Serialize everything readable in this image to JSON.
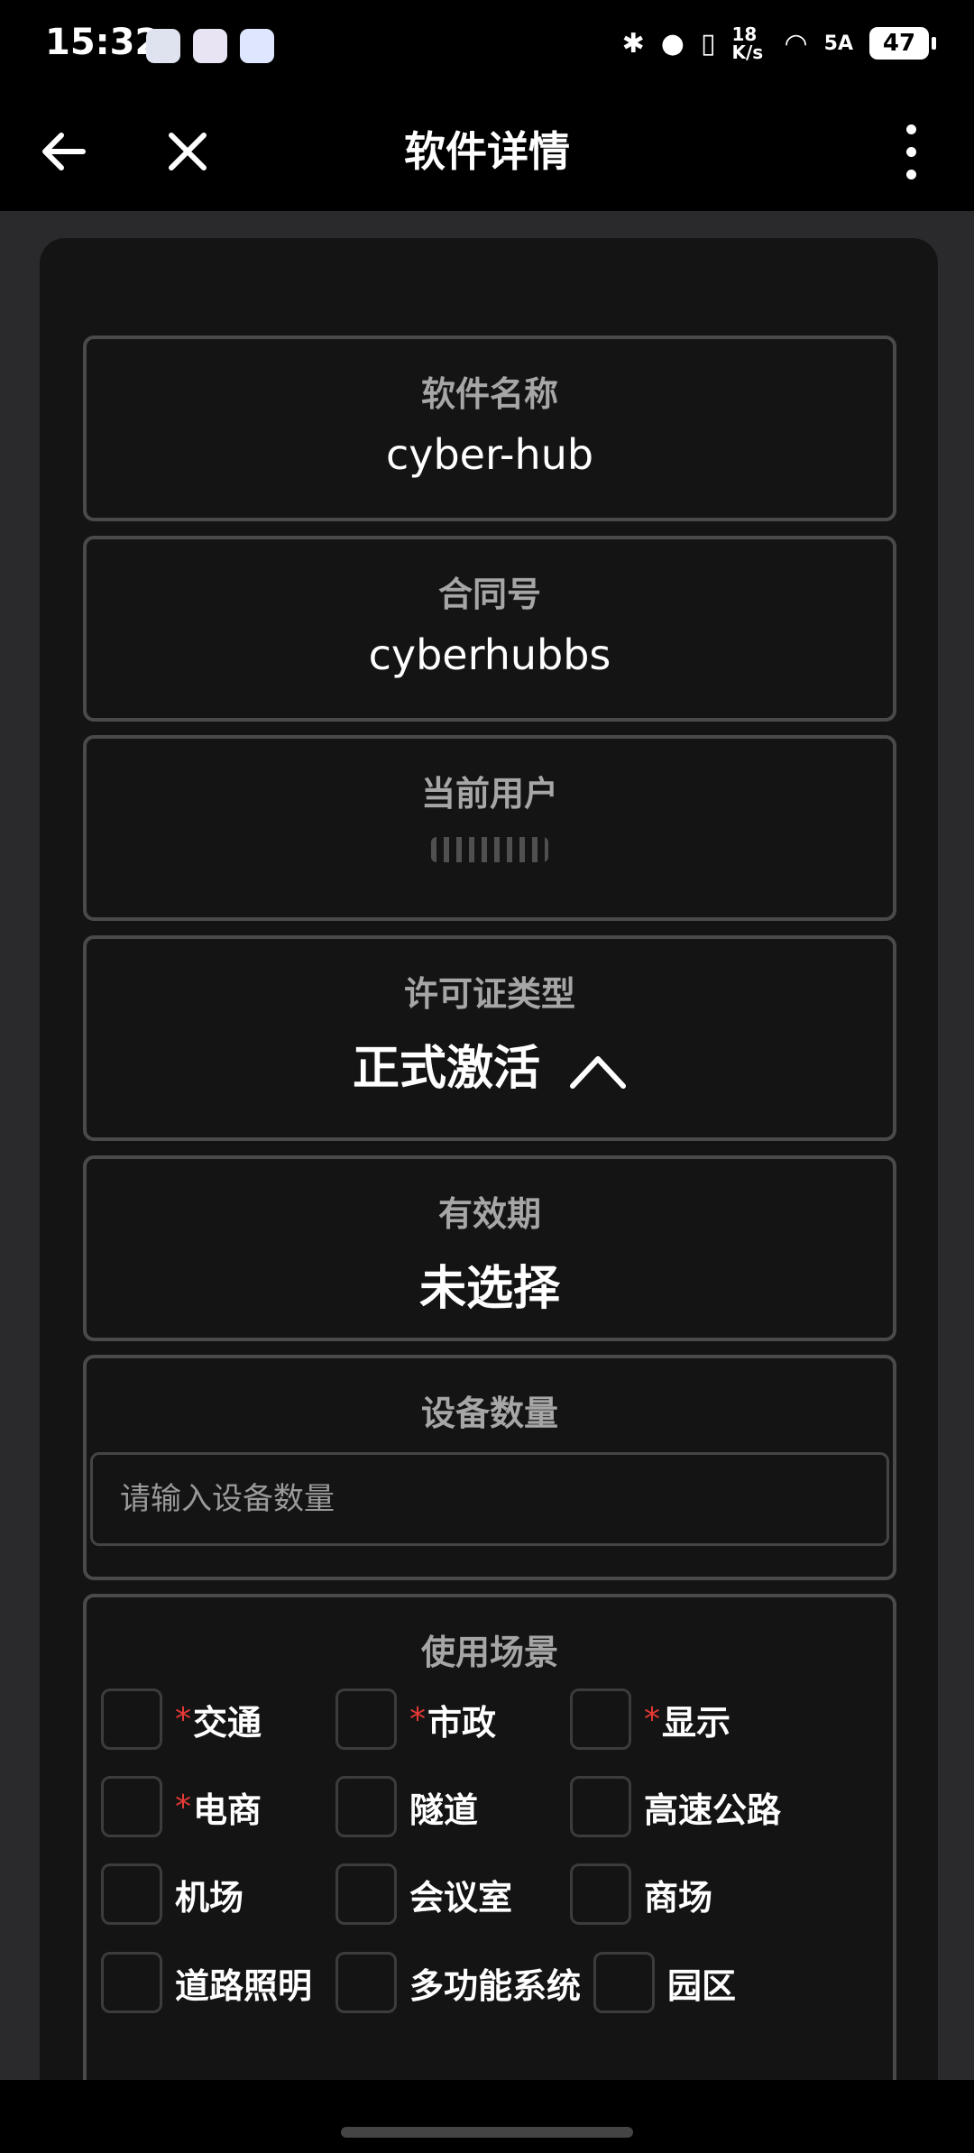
{
  "status_bar": {
    "time": "15:32",
    "net_speed": "18 K/s",
    "signal": "5A",
    "battery": "47",
    "app_icons": [
      "cat-app-icon",
      "tiktok-icon",
      "chat-bubble-icon"
    ]
  },
  "appbar": {
    "title": "软件详情"
  },
  "fields": {
    "software_name": {
      "label": "软件名称",
      "value": "cyber-hub"
    },
    "contract_no": {
      "label": "合同号",
      "value": "cyberhubbs"
    },
    "current_user": {
      "label": "当前用户"
    },
    "license_type": {
      "label": "许可证类型",
      "value": "正式激活"
    },
    "validity": {
      "label": "有效期",
      "value": "未选择"
    },
    "device_count": {
      "label": "设备数量",
      "placeholder": "请输入设备数量"
    },
    "usage_scene": {
      "label": "使用场景"
    }
  },
  "scenes": [
    {
      "text": "交通",
      "required": true
    },
    {
      "text": "市政",
      "required": true
    },
    {
      "text": "显示",
      "required": true
    },
    {
      "text": "电商",
      "required": true
    },
    {
      "text": "隧道",
      "required": false
    },
    {
      "text": "高速公路",
      "required": false
    },
    {
      "text": "机场",
      "required": false
    },
    {
      "text": "会议室",
      "required": false
    },
    {
      "text": "商场",
      "required": false
    },
    {
      "text": "道路照明",
      "required": false
    },
    {
      "text": "多功能系统",
      "required": false
    },
    {
      "text": "园区",
      "required": false
    }
  ],
  "required_mark": "*",
  "colors": {
    "required": "#e53935",
    "card": "#141414",
    "page": "#2a2a2c"
  }
}
